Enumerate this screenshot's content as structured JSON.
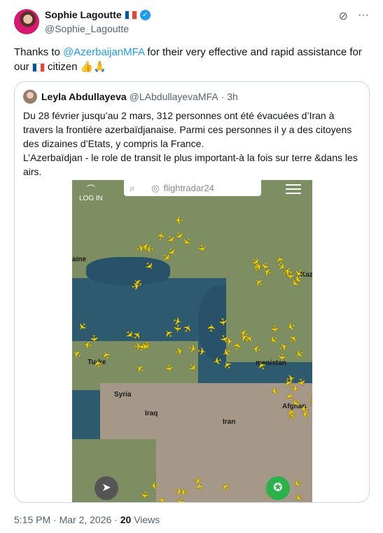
{
  "author": {
    "display_name": "Sophie Lagoutte",
    "handle": "@Sophie_Lagoutte",
    "verified_icon": "check-icon"
  },
  "tweet": {
    "text_before": "Thanks to ",
    "mention": "@AzerbaijanMFA",
    "text_after": " for their very effective and rapid assistance for our ",
    "text_end": " citizen ",
    "emojis": "👍🙏"
  },
  "quote": {
    "display_name": "Leyla Abdullayeva",
    "handle": "@LAbdullayevaMFA",
    "time": "· 3h",
    "paragraph1": "Du 28 février jusqu’au 2 mars, 312 personnes ont été évacuées d’Iran à travers la frontière azerbaïdjanaise. Parmi ces personnes il y a des citoyens des dizaines d’Etats, y compris la France.",
    "paragraph2": "L’Azerbaïdjan - le role de transit le plus important-à la fois sur terre &dans les airs."
  },
  "map": {
    "app_name": "flightradar24",
    "login_label": "LOG IN",
    "labels": {
      "syria": "Syria",
      "iraq": "Iraq",
      "iran": "Iran",
      "turkey": "Turke",
      "kaz": "Kaz",
      "afgh": "Afghan",
      "turkmen": "menistan",
      "ukraine": "aine"
    }
  },
  "meta": {
    "time": "5:15 PM · Mar 2, 2026 · ",
    "views_count": "20",
    "views_label": " Views"
  },
  "colors": {
    "accent": "#1d9bf0",
    "plane": "#f5d40a"
  }
}
